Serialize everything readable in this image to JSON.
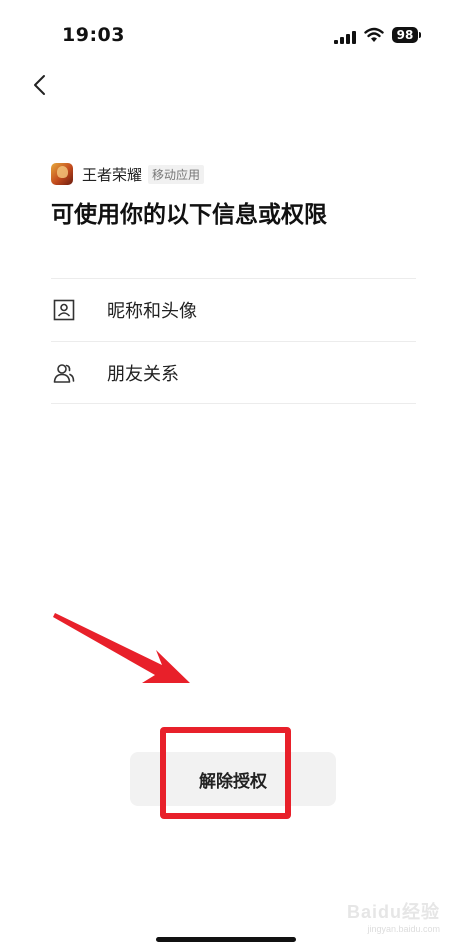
{
  "status_bar": {
    "time": "19:03",
    "battery_level": "98"
  },
  "app": {
    "name": "王者荣耀",
    "tag": "移动应用"
  },
  "title": "可使用你的以下信息或权限",
  "permissions": [
    {
      "label": "昵称和头像",
      "icon": "profile-card-icon"
    },
    {
      "label": "朋友关系",
      "icon": "friends-icon"
    }
  ],
  "unbind_button": {
    "label": "解除授权"
  },
  "watermark": {
    "logo": "Baidu经验",
    "url": "jingyan.baidu.com"
  },
  "colors": {
    "highlight": "#e8202a",
    "button_bg": "#f2f2f2"
  }
}
